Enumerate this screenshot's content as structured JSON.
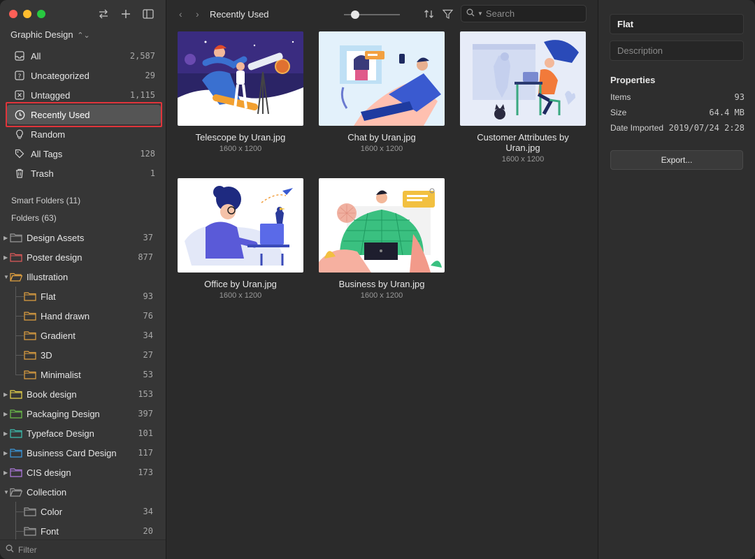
{
  "sidebar": {
    "library_name": "Graphic Design",
    "nav": [
      {
        "label": "All",
        "count": "2,587",
        "icon": "inbox-icon"
      },
      {
        "label": "Uncategorized",
        "count": "29",
        "icon": "question-box-icon"
      },
      {
        "label": "Untagged",
        "count": "1,115",
        "icon": "tag-x-icon"
      },
      {
        "label": "Recently Used",
        "count": "",
        "icon": "clock-icon"
      },
      {
        "label": "Random",
        "count": "",
        "icon": "lightbulb-icon"
      },
      {
        "label": "All Tags",
        "count": "128",
        "icon": "tag-icon"
      },
      {
        "label": "Trash",
        "count": "1",
        "icon": "trash-icon"
      }
    ],
    "smart_folders": "Smart Folders (11)",
    "folders_header": "Folders (63)",
    "folders": [
      {
        "label": "Design Assets",
        "count": "37",
        "color": "#9a9a9a"
      },
      {
        "label": "Poster design",
        "count": "877",
        "color": "#e05a5a"
      },
      {
        "label": "Illustration",
        "count": "",
        "color": "#e0a040"
      },
      {
        "label": "Flat",
        "count": "93",
        "color": "#e0a040"
      },
      {
        "label": "Hand drawn",
        "count": "76",
        "color": "#e0a040"
      },
      {
        "label": "Gradient",
        "count": "34",
        "color": "#e0a040"
      },
      {
        "label": "3D",
        "count": "27",
        "color": "#e0a040"
      },
      {
        "label": "Minimalist",
        "count": "53",
        "color": "#e0a040"
      },
      {
        "label": "Book design",
        "count": "153",
        "color": "#e8d44a"
      },
      {
        "label": "Packaging Design",
        "count": "397",
        "color": "#6cc04a"
      },
      {
        "label": "Typeface Design",
        "count": "101",
        "color": "#3cc0b0"
      },
      {
        "label": "Business Card Design",
        "count": "117",
        "color": "#3a9ae0"
      },
      {
        "label": "CIS design",
        "count": "173",
        "color": "#b07ae0"
      },
      {
        "label": "Collection",
        "count": "",
        "color": "#9a9a9a"
      },
      {
        "label": "Color",
        "count": "34",
        "color": "#9a9a9a"
      },
      {
        "label": "Font",
        "count": "20",
        "color": "#9a9a9a"
      }
    ],
    "filter_placeholder": "Filter"
  },
  "toolbar": {
    "title": "Recently Used",
    "search_placeholder": "Search"
  },
  "items": [
    {
      "name": "Telescope by Uran.jpg",
      "dims": "1600 x 1200"
    },
    {
      "name": "Chat by Uran.jpg",
      "dims": "1600 x 1200"
    },
    {
      "name": "Customer Attributes by Uran.jpg",
      "dims": "1600 x 1200"
    },
    {
      "name": "Office by Uran.jpg",
      "dims": "1600 x 1200"
    },
    {
      "name": "Business by Uran.jpg",
      "dims": "1600 x 1200"
    }
  ],
  "inspector": {
    "name_value": "Flat",
    "description_placeholder": "Description",
    "properties_title": "Properties",
    "props": [
      {
        "key": "Items",
        "value": "93"
      },
      {
        "key": "Size",
        "value": "64.4 MB"
      },
      {
        "key": "Date Imported",
        "value": "2019/07/24 2:28"
      }
    ],
    "export_label": "Export..."
  }
}
